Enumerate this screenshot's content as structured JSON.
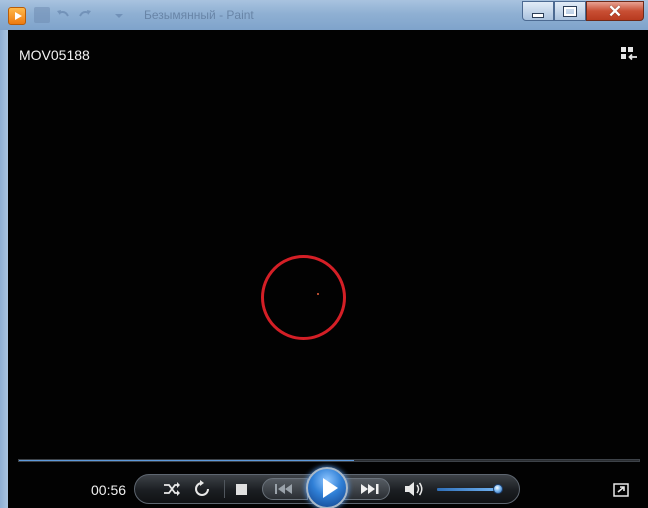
{
  "window": {
    "title": "Безымянный - Paint",
    "buttons": {
      "minimize": "minimize",
      "maximize": "maximize",
      "close": "✕"
    }
  },
  "player": {
    "media_title": "MOV05188",
    "time_elapsed": "00:56",
    "seek_progress": 0.54,
    "volume_level": 0.93
  },
  "colors": {
    "accent": "#3d7cc9",
    "annotation_circle": "#d41f26",
    "background": "#020202"
  },
  "icons": [
    "app-icon",
    "switch-to-library-icon",
    "shuffle-icon",
    "repeat-icon",
    "stop-icon",
    "previous-icon",
    "play-icon",
    "next-icon",
    "volume-icon",
    "fullscreen-icon"
  ]
}
